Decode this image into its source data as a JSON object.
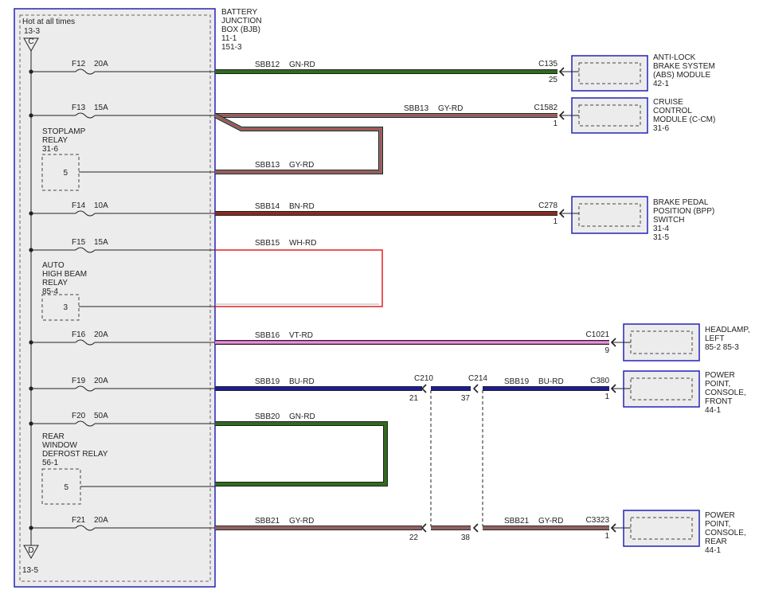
{
  "bjb": {
    "title_lines": [
      "BATTERY",
      "JUNCTION",
      "BOX (BJB)",
      "11-1",
      "151-3"
    ],
    "hot_label": "Hot at all times",
    "top_ref": "13-3",
    "top_connector": "C",
    "bottom_connector": "D",
    "bottom_ref": "13-5"
  },
  "fuses": [
    {
      "id": "F12",
      "rating": "20A"
    },
    {
      "id": "F13",
      "rating": "15A"
    },
    {
      "id": "F14",
      "rating": "10A"
    },
    {
      "id": "F15",
      "rating": "15A"
    },
    {
      "id": "F16",
      "rating": "20A"
    },
    {
      "id": "F19",
      "rating": "20A"
    },
    {
      "id": "F20",
      "rating": "50A"
    },
    {
      "id": "F21",
      "rating": "20A"
    }
  ],
  "relays": [
    {
      "lines": [
        "STOPLAMP",
        "RELAY",
        "31-6"
      ],
      "pin": "5"
    },
    {
      "lines": [
        "AUTO",
        "HIGH BEAM",
        "RELAY",
        "85-4"
      ],
      "pin": "3"
    },
    {
      "lines": [
        "REAR",
        "WINDOW",
        "DEFROST RELAY",
        "56-1"
      ],
      "pin": "5"
    }
  ],
  "wires": [
    {
      "circuit": "SBB12",
      "color_code": "GN-RD",
      "main": "#2f6b1e",
      "stripe": ""
    },
    {
      "circuit": "SBB13",
      "color_code": "GY-RD",
      "main": "#7a7a7a",
      "stripe": "#c2403a"
    },
    {
      "circuit": "SBB13",
      "color_code": "GY-RD",
      "main": "#7a7a7a",
      "stripe": "#c2403a"
    },
    {
      "circuit": "SBB14",
      "color_code": "BN-RD",
      "main": "#8a2b22",
      "stripe": ""
    },
    {
      "circuit": "SBB15",
      "color_code": "WH-RD",
      "main": "#e02020",
      "stripe": ""
    },
    {
      "circuit": "SBB16",
      "color_code": "VT-RD",
      "main": "#c060b0",
      "stripe": "#f0a8e0"
    },
    {
      "circuit": "SBB19",
      "color_code": "BU-RD",
      "main": "#1c1c9a",
      "stripe": ""
    },
    {
      "circuit": "SBB19",
      "color_code": "BU-RD",
      "main": "#1c1c9a",
      "stripe": ""
    },
    {
      "circuit": "SBB20",
      "color_code": "GN-RD",
      "main": "#2f6b1e",
      "stripe": ""
    },
    {
      "circuit": "SBB21",
      "color_code": "GY-RD",
      "main": "#7a7a7a",
      "stripe": "#c2403a"
    },
    {
      "circuit": "SBB21",
      "color_code": "GY-RD",
      "main": "#7a7a7a",
      "stripe": "#c2403a"
    }
  ],
  "inline_connectors": [
    {
      "id": "C210",
      "pins": [
        "21",
        "22"
      ]
    },
    {
      "id": "C214",
      "pins": [
        "37",
        "38"
      ]
    }
  ],
  "components": [
    {
      "connector": "C135",
      "pin": "25",
      "lines": [
        "ANTI-LOCK",
        "BRAKE SYSTEM",
        "(ABS) MODULE",
        "42-1"
      ]
    },
    {
      "connector": "C1582",
      "pin": "1",
      "lines": [
        "CRUISE",
        "CONTROL",
        "MODULE (C-CM)",
        "31-6"
      ]
    },
    {
      "connector": "C278",
      "pin": "1",
      "lines": [
        "BRAKE PEDAL",
        "POSITION (BPP)",
        "SWITCH",
        "31-4",
        "31-5"
      ]
    },
    {
      "connector": "C1021",
      "pin": "9",
      "lines": [
        "HEADLAMP,",
        "LEFT",
        "85-2   85-3"
      ]
    },
    {
      "connector": "C380",
      "pin": "1",
      "lines": [
        "POWER",
        "POINT,",
        "CONSOLE,",
        "FRONT",
        "44-1"
      ]
    },
    {
      "connector": "C3323",
      "pin": "1",
      "lines": [
        "POWER",
        "POINT,",
        "CONSOLE,",
        "REAR",
        "44-1"
      ]
    }
  ]
}
